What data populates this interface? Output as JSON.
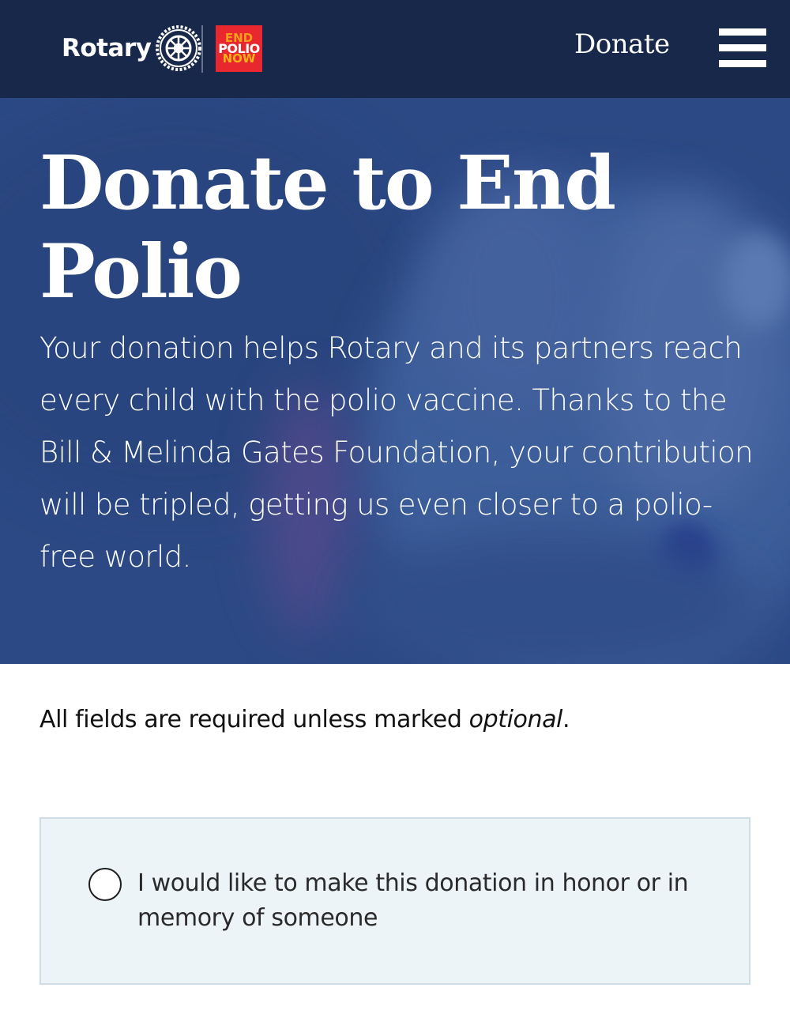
{
  "header": {
    "logo_text": "Rotary",
    "emblem_label": "Rotary International",
    "epn_logo": {
      "line1": "END",
      "line2": "POLIO",
      "line3": "NOW"
    },
    "donate_label": "Donate",
    "menu_icon": "hamburger-menu-icon"
  },
  "hero": {
    "title": "Donate to End Polio",
    "body": "Your donation helps Rotary and its partners reach every child with the polio vaccine. Thanks to the Bill & Melinda Gates Foundation, your contribution will be tripled, getting us even closer to a polio-free world."
  },
  "form": {
    "required_note_prefix": "All fields are required unless marked ",
    "required_note_em": "optional",
    "required_note_suffix": ".",
    "honor_label": "I would like to make this donation in honor or in memory of someone"
  },
  "colors": {
    "header_bg": "#17284a",
    "hero_overlay": "#34528d",
    "epn_red": "#e8282e",
    "honor_box_bg": "#edf4f8"
  }
}
